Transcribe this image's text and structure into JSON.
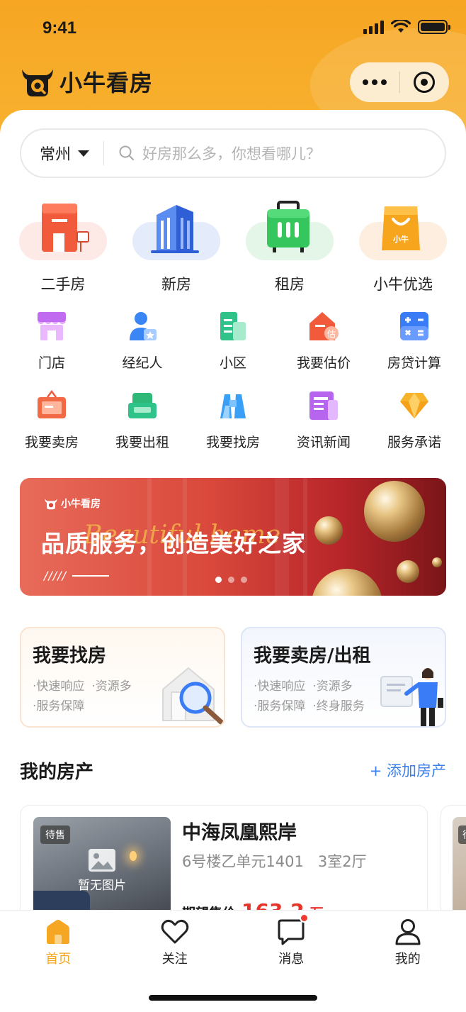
{
  "status_bar": {
    "time": "9:41"
  },
  "header": {
    "app_name": "小牛看房"
  },
  "search": {
    "city": "常州",
    "placeholder": "好房那么多，你想看哪儿？"
  },
  "main_categories": [
    {
      "label": "二手房",
      "icon": "building-red-icon",
      "color": "#f25a3c"
    },
    {
      "label": "新房",
      "icon": "skyscraper-blue-icon",
      "color": "#3a6fe0"
    },
    {
      "label": "租房",
      "icon": "suitcase-green-icon",
      "color": "#2fc25b"
    },
    {
      "label": "小牛优选",
      "icon": "shopping-bag-orange-icon",
      "color": "#f7a51c"
    }
  ],
  "shortcuts": [
    [
      {
        "label": "门店",
        "icon": "storefront-icon"
      },
      {
        "label": "经纪人",
        "icon": "agent-icon"
      },
      {
        "label": "小区",
        "icon": "community-icon"
      },
      {
        "label": "我要估价",
        "icon": "valuation-icon"
      },
      {
        "label": "房贷计算",
        "icon": "calculator-icon"
      }
    ],
    [
      {
        "label": "我要卖房",
        "icon": "sell-sign-icon"
      },
      {
        "label": "我要出租",
        "icon": "sofa-icon"
      },
      {
        "label": "我要找房",
        "icon": "binoculars-icon"
      },
      {
        "label": "资讯新闻",
        "icon": "news-icon"
      },
      {
        "label": "服务承诺",
        "icon": "diamond-icon"
      }
    ]
  ],
  "banner": {
    "brand": "小牛看房",
    "slogan": "品质服务，创造美好之家",
    "script": "Beautiful home",
    "slashes": "/////",
    "active_slide": 1,
    "slides": 3
  },
  "service_cards": {
    "find": {
      "title": "我要找房",
      "features": [
        "·快速响应",
        "·资源多",
        "·服务保障"
      ]
    },
    "sell": {
      "title": "我要卖房/出租",
      "features": [
        "·快速响应",
        "·资源多",
        "·服务保障",
        "·终身服务"
      ]
    }
  },
  "my_property": {
    "title": "我的房产",
    "add_label": "+ 添加房产",
    "items": [
      {
        "status": "待售",
        "no_image": "暂无图片",
        "name": "中海凤凰熙岸",
        "address": "6号楼乙单元1401",
        "layout": "3室2厅",
        "price_label": "期望售价",
        "price": "163.2",
        "price_unit": "万"
      },
      {
        "status": "待"
      }
    ]
  },
  "tabbar": {
    "items": [
      {
        "label": "首页",
        "icon": "home-icon",
        "active": true
      },
      {
        "label": "关注",
        "icon": "heart-icon",
        "active": false
      },
      {
        "label": "消息",
        "icon": "message-icon",
        "active": false,
        "badge": true
      },
      {
        "label": "我的",
        "icon": "user-icon",
        "active": false
      }
    ]
  },
  "colors": {
    "brand": "#f5a623",
    "price": "#e8332a",
    "link": "#3b7ff0"
  }
}
